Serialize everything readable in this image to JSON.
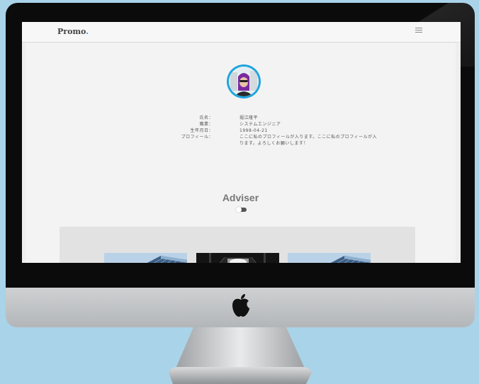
{
  "site": {
    "logo_text": "Promo",
    "logo_dot": ".",
    "accent_color": "#2a9fd6",
    "menu_icon": "hamburger-icon"
  },
  "profile": {
    "avatar_icon": "user-avatar",
    "rows": [
      {
        "label": "氏名：",
        "value": "堀江隆平"
      },
      {
        "label": "職業：",
        "value": "システムエンジニア"
      },
      {
        "label": "生年月日：",
        "value": "1998-04-21"
      },
      {
        "label": "プロフィール：",
        "value": "ここに私のプロフィールが入ります。ここに私のプロフィールが入ります。よろしくお願いします！"
      }
    ]
  },
  "adviser": {
    "title": "Adviser",
    "toggle_on": false,
    "cards": [
      {
        "image": "office-building-photo"
      },
      {
        "image": "ceiling-light-photo"
      },
      {
        "image": "office-building-photo"
      }
    ]
  }
}
